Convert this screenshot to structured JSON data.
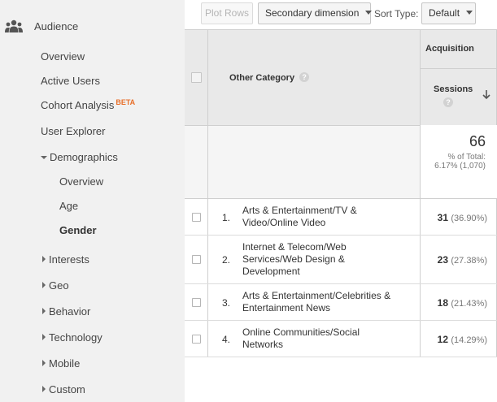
{
  "sidebar": {
    "section_label": "Audience",
    "section_icon": "people-icon",
    "items": {
      "overview": "Overview",
      "active_users": "Active Users",
      "cohort_analysis": "Cohort Analysis",
      "cohort_badge": "BETA",
      "user_explorer": "User Explorer",
      "demographics": "Demographics",
      "demo_overview": "Overview",
      "demo_age": "Age",
      "demo_gender": "Gender",
      "interests": "Interests",
      "geo": "Geo",
      "behavior": "Behavior",
      "technology": "Technology",
      "mobile": "Mobile",
      "custom": "Custom"
    },
    "selected": "Gender"
  },
  "toolbar": {
    "plot_rows": "Plot Rows",
    "secondary_dimension": "Secondary dimension",
    "sort_type_label": "Sort Type:",
    "sort_type_value": "Default"
  },
  "table": {
    "group_header": "Acquisition",
    "dimension_header": "Other Category",
    "metric_header": "Sessions",
    "totals": {
      "value": "66",
      "pct_label": "% of Total:",
      "pct_value": "6.17% (1,070)"
    },
    "rows": [
      {
        "num": "1.",
        "line1": "Arts & Entertainment/TV &",
        "line2": "Video/Online Video",
        "line3": "",
        "value": "31",
        "pct": "(36.90%)"
      },
      {
        "num": "2.",
        "line1": "Internet & Telecom/Web",
        "line2": "Services/Web Design &",
        "line3": "Development",
        "value": "23",
        "pct": "(27.38%)"
      },
      {
        "num": "3.",
        "line1": "Arts & Entertainment/Celebrities &",
        "line2": "Entertainment News",
        "line3": "",
        "value": "18",
        "pct": "(21.43%)"
      },
      {
        "num": "4.",
        "line1": "Online Communities/Social",
        "line2": "Networks",
        "line3": "",
        "value": "12",
        "pct": "(14.29%)"
      }
    ]
  },
  "colors": {
    "sidebar_bg": "#f1f1f1",
    "header_bg": "#e9e9e9",
    "beta_orange": "#e8702a"
  }
}
